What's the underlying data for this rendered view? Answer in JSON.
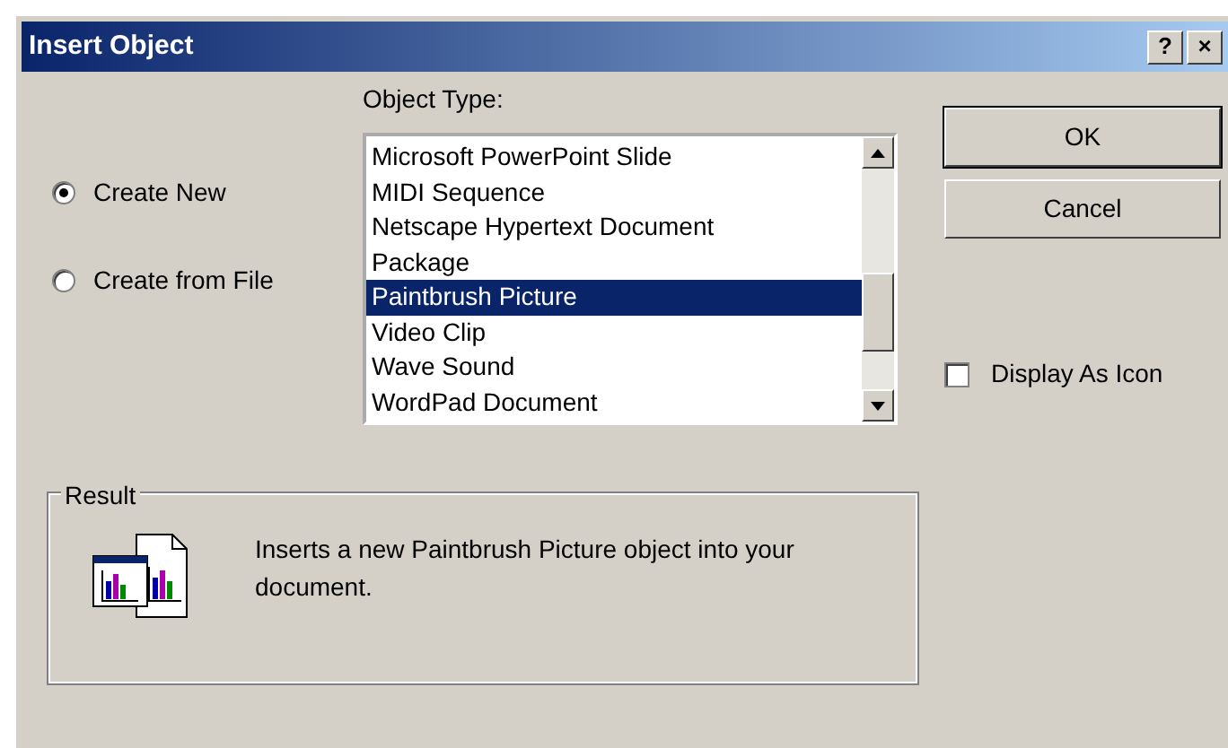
{
  "window": {
    "title": "Insert Object",
    "title_buttons": [
      "?",
      "×"
    ]
  },
  "options": [
    {
      "label": "Create New",
      "selected": true
    },
    {
      "label": "Create from File",
      "selected": false
    }
  ],
  "object_type": {
    "label": "Object Type:",
    "items": [
      {
        "label": "Microsoft PowerPoint Slide",
        "selected": false
      },
      {
        "label": "MIDI Sequence",
        "selected": false
      },
      {
        "label": "Netscape Hypertext Document",
        "selected": false
      },
      {
        "label": "Package",
        "selected": false
      },
      {
        "label": "Paintbrush Picture",
        "selected": true
      },
      {
        "label": "Video Clip",
        "selected": false
      },
      {
        "label": "Wave Sound",
        "selected": false
      },
      {
        "label": "WordPad Document",
        "selected": false
      }
    ]
  },
  "buttons": [
    "OK",
    "Cancel"
  ],
  "display_as_icon": {
    "label": "Display As Icon",
    "checked": false
  },
  "result": {
    "label": "Result",
    "text": "Inserts a new Paintbrush Picture object into your document."
  }
}
